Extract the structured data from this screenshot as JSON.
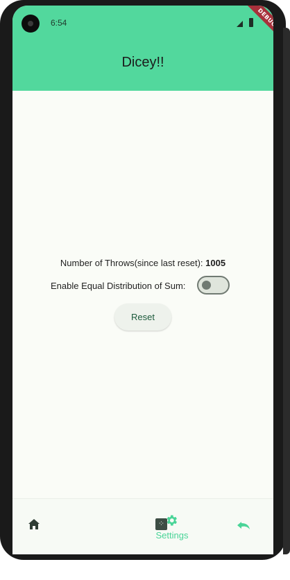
{
  "status_bar": {
    "time": "6:54",
    "signal_icon": "signal-icon",
    "battery_icon": "battery-icon"
  },
  "debug_banner": "DEBUG",
  "app_bar": {
    "title": "Dicey!!"
  },
  "main": {
    "throws_label": "Number of Throws(since last reset): ",
    "throws_count": "1005",
    "distribution_label": "Enable Equal Distribution of Sum:",
    "distribution_enabled": false,
    "reset_label": "Reset"
  },
  "bottom_nav": {
    "items": [
      {
        "icon": "home-icon",
        "label": ""
      },
      {
        "icon": "dice-icon",
        "label": ""
      },
      {
        "icon": "gear-icon",
        "label": "Settings",
        "selected": true
      },
      {
        "icon": "undo-icon",
        "label": ""
      }
    ]
  },
  "colors": {
    "app_bar": "#52d89d",
    "accent": "#49d497",
    "background": "#fafcf7",
    "debug_banner": "#a7313b"
  }
}
